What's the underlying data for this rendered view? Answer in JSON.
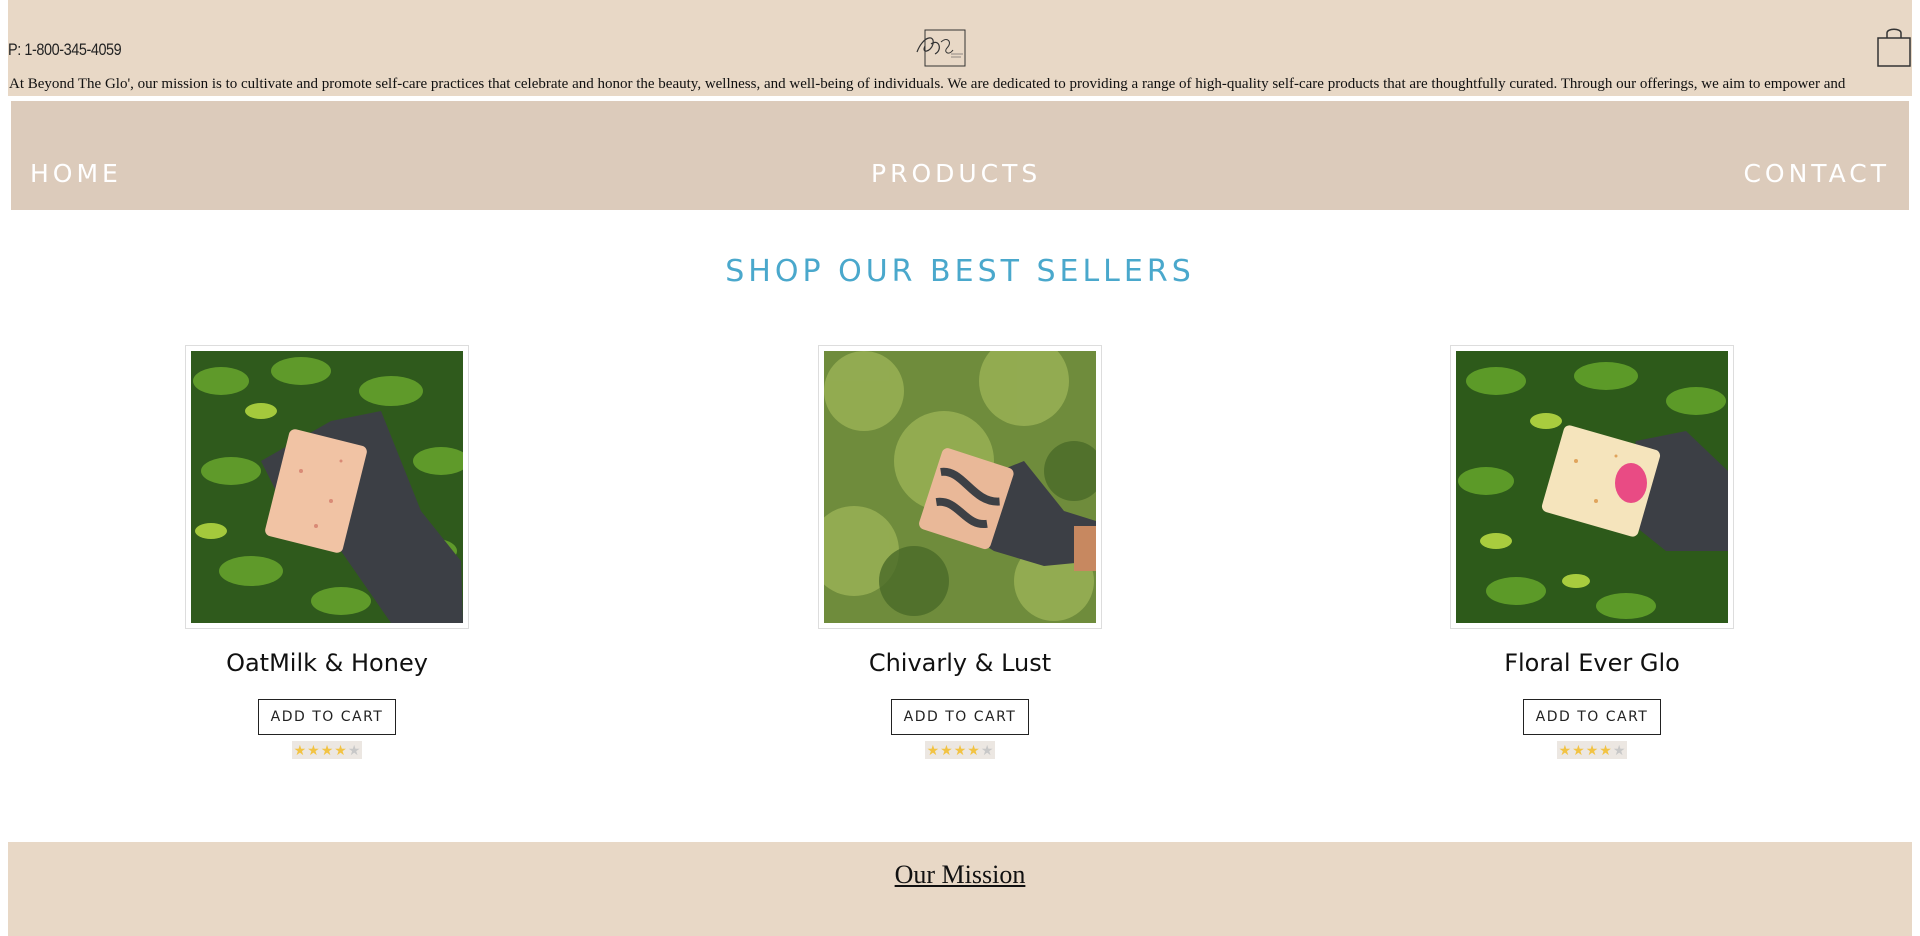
{
  "header": {
    "phone": "P: 1-800-345-4059",
    "logo_icon": "bg-monogram-logo",
    "cart_icon": "shopping-bag-icon"
  },
  "nav": {
    "home": "HOME",
    "products": "PRODUCTS",
    "contact": "CONTACT"
  },
  "section": {
    "title": "SHOP OUR BEST SELLERS"
  },
  "products": [
    {
      "name": "OatMilk & Honey",
      "button": "ADD TO CART",
      "rating": 4,
      "rating_max": 5
    },
    {
      "name": "Chivarly & Lust",
      "button": "ADD TO CART",
      "rating": 4,
      "rating_max": 5
    },
    {
      "name": "Floral Ever Glo",
      "button": "ADD TO CART",
      "rating": 4,
      "rating_max": 5
    }
  ],
  "mission": {
    "title": "Our Mission",
    "text": "At Beyond The Glo', our mission is to cultivate and promote self-care practices that celebrate and honor the beauty, wellness, and well-being of individuals. We are dedicated to providing a range of high-quality self-care products that are thoughtfully curated. Through our offerings, we aim to empower and"
  },
  "colors": {
    "topbar": "#e8d8c6",
    "navbar": "#dccbbb",
    "accent_title": "#4aa8cc",
    "star": "#f2c343"
  }
}
